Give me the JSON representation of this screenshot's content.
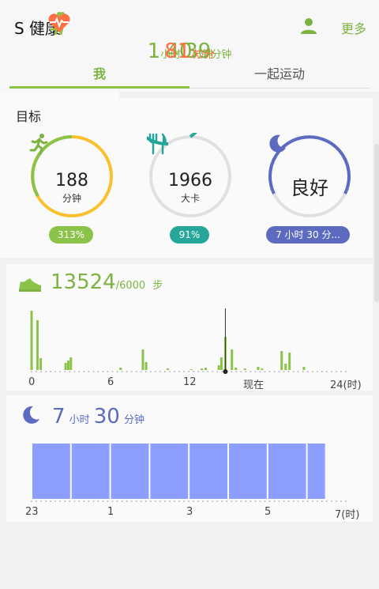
{
  "appbar": {
    "title": "S 健康",
    "more_label": "更多"
  },
  "tabs": [
    {
      "label": "我"
    },
    {
      "label": "一起运动"
    }
  ],
  "goals": {
    "title": "目标",
    "rings": [
      {
        "number": "188",
        "unit": "分钟",
        "badge": "313%",
        "color": "#8bc34a"
      },
      {
        "number": "1966",
        "unit": "大卡",
        "badge": "91%",
        "color": "#26a69a"
      },
      {
        "quality": "良好",
        "badge": "7 小时 30 分...",
        "color": "#5c6bc0"
      }
    ]
  },
  "steps": {
    "value": "13524",
    "target": "/6000",
    "unit": "步",
    "x_labels": [
      "0",
      "6",
      "12",
      "现在",
      "24(时)"
    ]
  },
  "sleep": {
    "hours": "7",
    "hours_unit": "小时",
    "minutes": "30",
    "minutes_unit": "分钟",
    "x_labels": [
      "23",
      "1",
      "3",
      "5",
      "7(时)"
    ]
  },
  "mini_cards": [
    {
      "value1": "1",
      "unit1": "小时",
      "value2": "39",
      "unit2": "分钟",
      "icon": "walking-icon",
      "color": "#8bc34a"
    },
    {
      "value1": "40",
      "unit1": "分钟",
      "icon": "running-icon",
      "color": "#8bc34a"
    },
    {
      "value1": "81",
      "unit1": "次/分",
      "icon": "heart-rate-icon",
      "color": "#ff7043"
    }
  ],
  "chart_data": [
    {
      "type": "bar",
      "title": "",
      "xlabel": "",
      "ylabel": "",
      "xlim": [
        0,
        24
      ],
      "x_ticks": [
        "0",
        "6",
        "12",
        "现在",
        "24(时)"
      ],
      "x": [
        0.0,
        0.2,
        0.45,
        0.7,
        2.6,
        2.8,
        3.0,
        6.8,
        8.5,
        8.75,
        10.4,
        12.2,
        13.0,
        13.3,
        14.3,
        14.5,
        14.8,
        15.3,
        15.6,
        16.3,
        17.3,
        17.6,
        19.1,
        19.4,
        19.7,
        20.8
      ],
      "values": [
        75,
        0,
        63,
        15,
        9,
        12,
        16,
        3,
        26,
        10,
        2,
        1,
        2,
        3,
        6,
        16,
        42,
        26,
        3,
        2,
        4,
        2,
        24,
        8,
        22,
        4
      ],
      "current_time": 14.8
    },
    {
      "type": "bar",
      "title": "",
      "xlabel": "",
      "ylabel": "",
      "x_ticks": [
        "23",
        "1",
        "3",
        "5",
        "7(时)"
      ],
      "segments": 8,
      "sleep_start": "23:00",
      "sleep_end": "6:30"
    }
  ],
  "colors": {
    "accent": "#8bc34a",
    "teal": "#26a69a",
    "indigo": "#5c6bc0",
    "sleep_bar": "#8c9eff",
    "heart": "#ff7043"
  }
}
